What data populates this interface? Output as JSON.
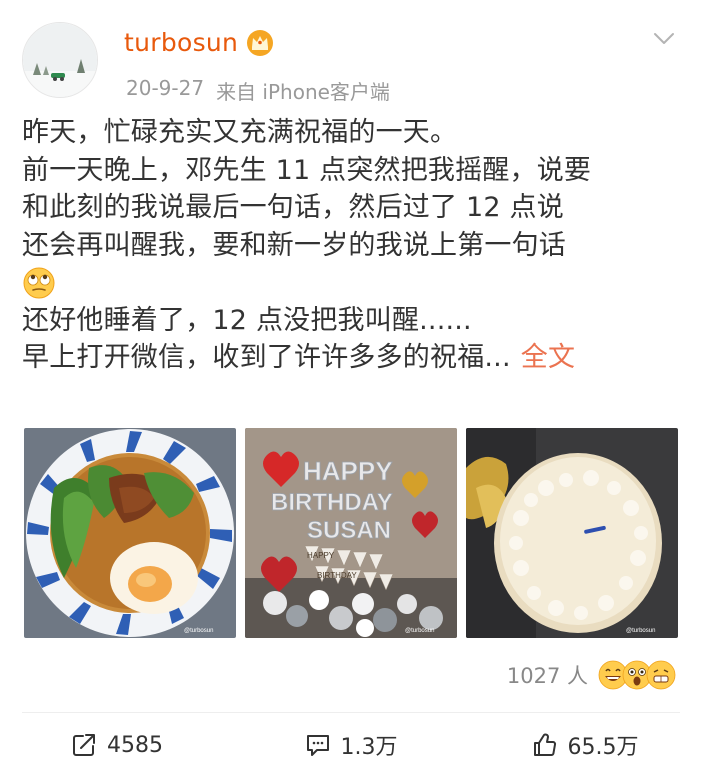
{
  "post": {
    "author": "turbosun",
    "date": "20-9-27",
    "source": "来自 iPhone客户端",
    "badge_icon": "crown-icon",
    "text_lines": [
      "昨天，忙碌充实又充满祝福的一天。",
      "前一天晚上，邓先生 11 点突然把我摇醒，说要",
      "和此刻的我说最后一句话，然后过了 12 点说",
      "还会再叫醒我，要和新一岁的我说上第一句话",
      "还好他睡着了，12 点没把我叫醒......",
      "早上打开微信，收到了许许多多的祝福..."
    ],
    "full_text_link": "全文",
    "inline_emoji": "eye-roll-emoji",
    "photos": [
      {
        "icon": "noodle-soup-photo",
        "watermark": "@turbosun"
      },
      {
        "icon": "birthday-balloons-photo",
        "watermark": "@turbosun"
      },
      {
        "icon": "birthday-cake-photo",
        "watermark": "@turbosun"
      }
    ],
    "balloon_letters": [
      "HAPPY",
      "BIRTHDAY",
      "SUSAN"
    ],
    "banner_letters": [
      "HAPPY",
      "BIRTHDAY"
    ],
    "reactions": {
      "count": "1027 人",
      "emojis": [
        "laugh-emoji",
        "shocked-emoji",
        "grin-emoji"
      ]
    }
  },
  "actions": {
    "share": {
      "icon": "share-icon",
      "count": "4585"
    },
    "comment": {
      "icon": "comment-icon",
      "count": "1.3万"
    },
    "like": {
      "icon": "thumbs-up-icon",
      "count": "65.5万"
    }
  },
  "colors": {
    "author": "#e8590c",
    "link": "#eb7350",
    "meta": "#999999",
    "text": "#333333"
  }
}
